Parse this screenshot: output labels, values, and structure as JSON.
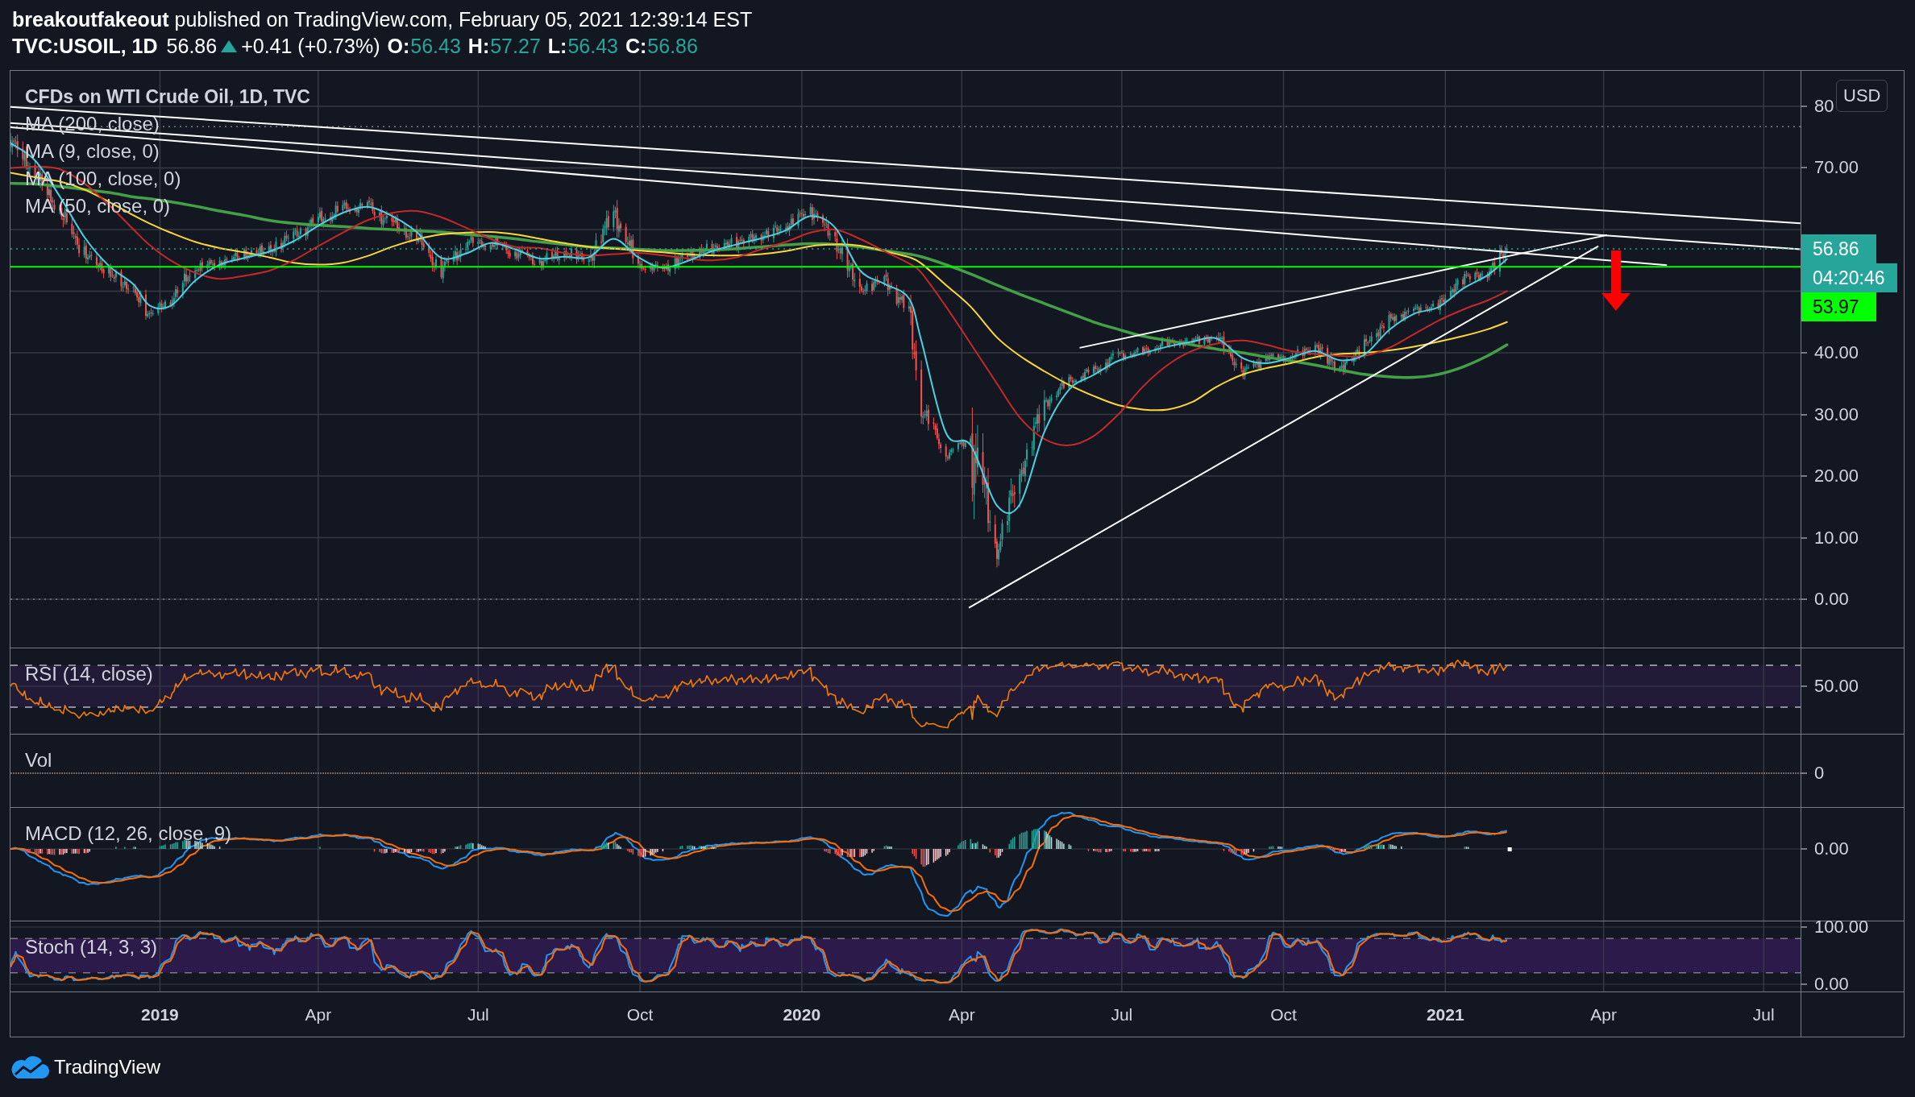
{
  "header": {
    "author": "breakoutfakeout",
    "byline": "published on TradingView.com, February 05, 2021 12:39:14 EST"
  },
  "quote": {
    "symbol": "TVC:USOIL, 1D",
    "last": "56.86",
    "rising": true,
    "change": "+0.41 (+0.73%)",
    "ohlc": [
      {
        "label": "O:",
        "value": "56.43"
      },
      {
        "label": "H:",
        "value": "57.27"
      },
      {
        "label": "L:",
        "value": "56.43"
      },
      {
        "label": "C:",
        "value": "56.86"
      }
    ]
  },
  "main_pane": {
    "title": "CFDs on WTI Crude Oil, 1D, TVC",
    "legend": [
      "MA (200, close)",
      "MA (9, close, 0)",
      "MA (100, close, 0)",
      "MA (50, close, 0)"
    ],
    "currency": "USD",
    "price_axis": [
      "80",
      "70.00",
      "40.00",
      "30.00",
      "20.00",
      "10.00",
      "0.00"
    ],
    "last_price_label": "56.86",
    "countdown": "04:20:46",
    "level_label": "53.97"
  },
  "indicator_panes": [
    {
      "kind": "rsi",
      "label": "RSI (14, close)",
      "ticks": [
        "50.00"
      ]
    },
    {
      "kind": "volume",
      "label": "Vol",
      "ticks": [
        "0"
      ]
    },
    {
      "kind": "macd",
      "label": "MACD (12, 26, close, 9)",
      "ticks": [
        "0.00"
      ]
    },
    {
      "kind": "stoch",
      "label": "Stoch (14, 3, 3)",
      "ticks": [
        "100.00",
        "0.00"
      ]
    }
  ],
  "time_axis": [
    {
      "label": "2019",
      "kind": "year"
    },
    {
      "label": "Apr",
      "kind": "month"
    },
    {
      "label": "Jul",
      "kind": "month"
    },
    {
      "label": "Oct",
      "kind": "month"
    },
    {
      "label": "2020",
      "kind": "year"
    },
    {
      "label": "Apr",
      "kind": "month"
    },
    {
      "label": "Jul",
      "kind": "month"
    },
    {
      "label": "Oct",
      "kind": "month"
    },
    {
      "label": "2021",
      "kind": "year"
    },
    {
      "label": "Apr",
      "kind": "month"
    },
    {
      "label": "Jul",
      "kind": "month"
    }
  ],
  "footer": {
    "brand": "TradingView"
  }
}
